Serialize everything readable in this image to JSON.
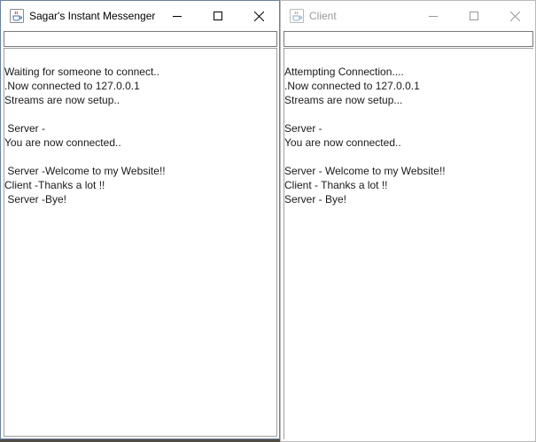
{
  "server_window": {
    "title": "Sagar's Instant Messenger",
    "input_value": "",
    "lines": [
      "Waiting for someone to connect..",
      ".Now connected to 127.0.0.1",
      "Streams are now setup..",
      "",
      " Server -",
      "You are now connected..",
      "",
      " Server -Welcome to my Website!!",
      "Client -Thanks a lot !!",
      " Server -Bye!"
    ]
  },
  "client_window": {
    "title": "Client",
    "input_value": "",
    "lines": [
      "Attempting Connection....",
      ".Now connected to 127.0.0.1",
      "Streams are now setup...",
      "",
      "Server -",
      "You are now connected..",
      "",
      "Server - Welcome to my Website!!",
      "Client - Thanks a lot !!",
      "Server - Bye!"
    ]
  },
  "icons": {
    "app": "java-cup-icon",
    "minimize": "minimize-icon",
    "maximize": "maximize-icon",
    "close": "close-icon"
  },
  "colors": {
    "active_border": "#6c7f9c",
    "inactive_title": "#999999"
  }
}
